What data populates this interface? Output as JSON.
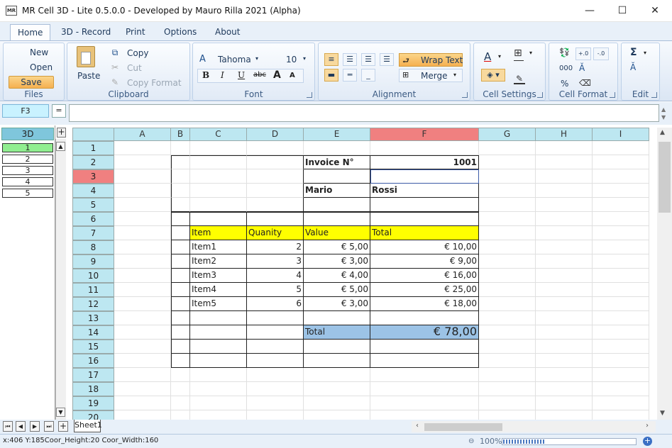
{
  "window": {
    "app_icon_text": "MR",
    "title": "MR Cell 3D - Lite 0.5.0.0 - Developed by Mauro Rilla 2021 (Alpha)",
    "minimize": "—",
    "maximize": "☐",
    "close": "✕"
  },
  "menu": {
    "tabs": [
      "Home",
      "3D - Record",
      "Print",
      "Options",
      "About"
    ]
  },
  "ribbon": {
    "files": {
      "new": "New",
      "open": "Open",
      "save": "Save",
      "label": "Files"
    },
    "clipboard": {
      "paste": "Paste",
      "copy": "Copy",
      "cut": "Cut",
      "copy_format": "Copy Format",
      "label": "Clipboard"
    },
    "font": {
      "name": "Tahoma",
      "size": "10",
      "bold": "B",
      "italic": "I",
      "underline": "U",
      "strike": "abc",
      "grow": "A",
      "shrink": "A",
      "label": "Font"
    },
    "alignment": {
      "wrap_text": "Wrap Text",
      "merge": "Merge",
      "label": "Alignment"
    },
    "cell_settings": {
      "label": "Cell Settings"
    },
    "cell_format": {
      "thousands": "000",
      "percent": "%",
      "label": "Cell Format"
    },
    "edit": {
      "sum": "Σ",
      "label": "Edit"
    }
  },
  "formula_bar": {
    "cell_ref": "F3",
    "eq": "=",
    "value": ""
  },
  "panel_3d": {
    "header": "3D",
    "add": "+",
    "layers": [
      "1",
      "2",
      "3",
      "4",
      "5"
    ]
  },
  "grid": {
    "columns": [
      "A",
      "B",
      "C",
      "D",
      "E",
      "F",
      "G",
      "H",
      "I"
    ],
    "rows": [
      "1",
      "2",
      "3",
      "4",
      "5",
      "6",
      "7",
      "8",
      "9",
      "10",
      "11",
      "12",
      "13",
      "14",
      "15",
      "16",
      "17",
      "18",
      "19",
      "20"
    ],
    "cells": {
      "E2": "Invoice N°",
      "F2": "1001",
      "E4": "Mario",
      "F4": "Rossi",
      "C7": "Item",
      "D7": "Quanity",
      "E7": "Value",
      "F7": "Total",
      "C8": "Item1",
      "D8": "2",
      "E8": "€ 5,00",
      "F8": "€ 10,00",
      "C9": "Item2",
      "D9": "3",
      "E9": "€ 3,00",
      "F9": "€ 9,00",
      "C10": "Item3",
      "D10": "4",
      "E10": "€ 4,00",
      "F10": "€ 16,00",
      "C11": "Item4",
      "D11": "5",
      "E11": "€ 5,00",
      "F11": "€ 25,00",
      "C12": "Item5",
      "D12": "6",
      "E12": "€ 3,00",
      "F12": "€ 18,00",
      "E14": "Total",
      "F14": "€ 78,00"
    }
  },
  "sheets": {
    "tabs": [
      "Sheet1"
    ],
    "add": "+"
  },
  "status": {
    "text": "x:406 Y:185Coor_Height:20 Coor_Width:160",
    "zoom": "100%"
  }
}
